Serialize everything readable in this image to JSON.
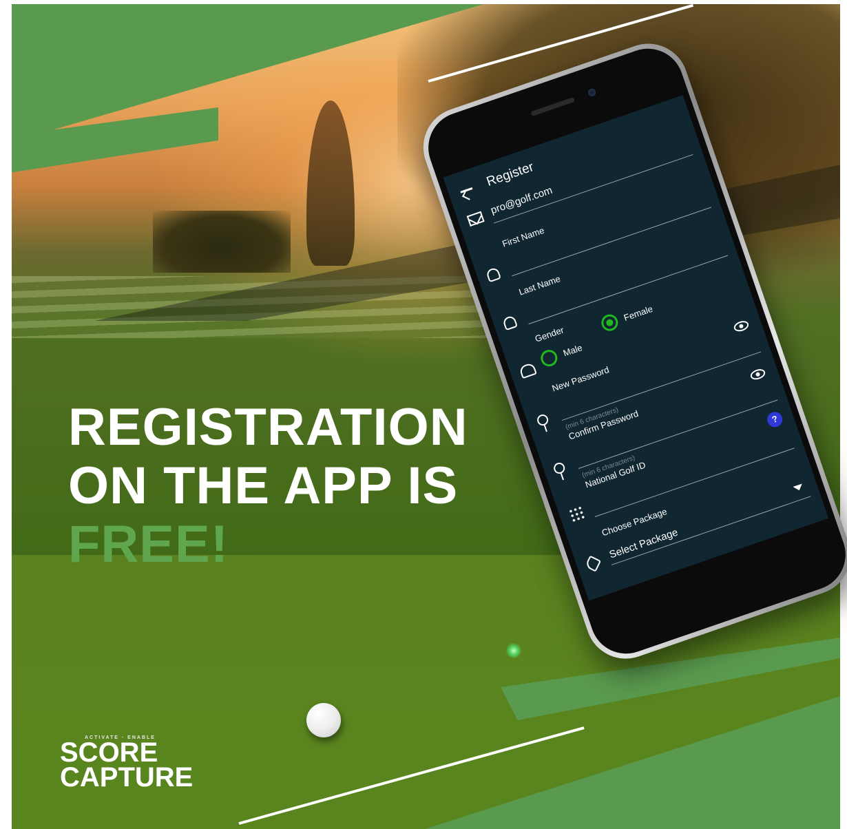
{
  "headline": {
    "line1": "REGISTRATION",
    "line2": "ON THE APP IS",
    "line3": "FREE!"
  },
  "logo": {
    "tagline": "ACTIVATE · ENABLE",
    "line1": "SCORE",
    "line2": "CAPTURE"
  },
  "app": {
    "title": "Register",
    "email_value": "pro@golf.com",
    "first_name_label": "First Name",
    "last_name_label": "Last Name",
    "gender_label": "Gender",
    "gender_options": [
      "Male",
      "Female"
    ],
    "gender_selected": "Female",
    "new_password_label": "New Password",
    "new_password_hint": "(min 6 characters)",
    "confirm_password_label": "Confirm Password",
    "confirm_password_hint": "(min 6 characters)",
    "national_golf_id_label": "National Golf ID",
    "help_label": "?",
    "package_label": "Choose Package",
    "package_value": "Select Package"
  },
  "colors": {
    "brand_green": "#5a9a4e",
    "screen_bg": "#102630",
    "radio_green": "#22b822",
    "help_blue": "#2f38d9"
  },
  "icons": [
    "back-arrow-icon",
    "mail-icon",
    "user-icon",
    "gender-icon",
    "eye-icon",
    "key-icon",
    "help-icon",
    "grid-icon",
    "dropdown-arrow-icon",
    "tag-icon"
  ]
}
